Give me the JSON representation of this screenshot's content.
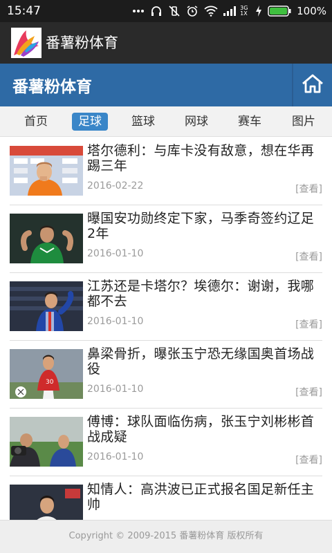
{
  "status_bar": {
    "time": "15:47",
    "network_label": "3G 1X",
    "battery": "100%",
    "icons": [
      "more-dots-icon",
      "headphones-icon",
      "vibrate-off-icon",
      "alarm-icon",
      "wifi-icon",
      "signal-icon",
      "charging-icon",
      "battery-icon"
    ]
  },
  "app_bar": {
    "title": "番薯粉体育",
    "logo_icon": "app-logo-icon"
  },
  "header": {
    "site_title": "番薯粉体育",
    "home_icon": "home-icon",
    "brand_color": "#2e6aa5"
  },
  "nav": {
    "tabs": [
      {
        "label": "首页",
        "active": false
      },
      {
        "label": "足球",
        "active": true
      },
      {
        "label": "篮球",
        "active": false
      },
      {
        "label": "网球",
        "active": false
      },
      {
        "label": "赛车",
        "active": false
      },
      {
        "label": "图片",
        "active": false
      }
    ],
    "active_color": "#3a86c8"
  },
  "articles": [
    {
      "title": "塔尔德利：与库卡没有敌意，想在华再踢三年",
      "date": "2016-02-22",
      "view_label": "[查看]"
    },
    {
      "title": "曝国安功勋终定下家，马季奇签约辽足2年",
      "date": "2016-01-10",
      "view_label": "[查看]"
    },
    {
      "title": "江苏还是卡塔尔？埃德尔：谢谢，我哪都不去",
      "date": "2016-01-10",
      "view_label": "[查看]"
    },
    {
      "title": "鼻梁骨折，曝张玉宁恐无缘国奥首场战役",
      "date": "2016-01-10",
      "view_label": "[查看]"
    },
    {
      "title": "傅博：球队面临伤病，张玉宁刘彬彬首战成疑",
      "date": "2016-01-10",
      "view_label": "[查看]"
    },
    {
      "title": "知情人：高洪波已正式报名国足新任主帅",
      "date": "",
      "view_label": ""
    }
  ],
  "footer": {
    "copyright": "Copyright © 2009-2015 番薯粉体育 版权所有"
  }
}
